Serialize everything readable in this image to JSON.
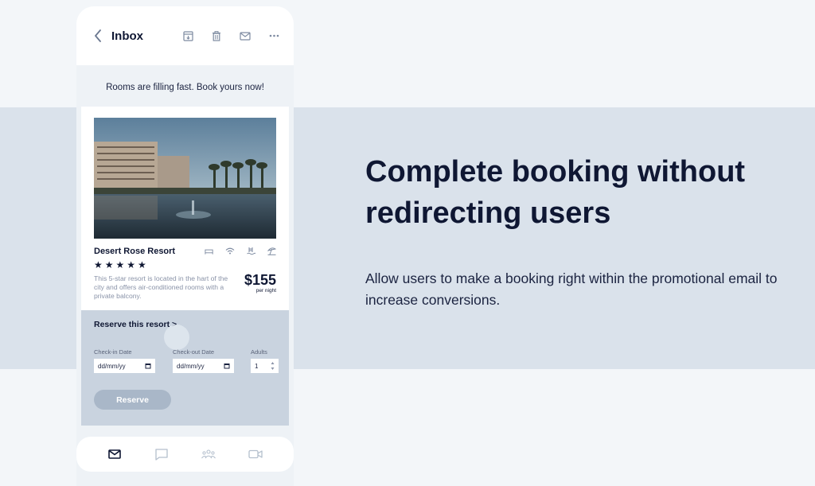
{
  "header": {
    "title": "Inbox",
    "icons": [
      "archive-icon",
      "trash-icon",
      "mail-icon",
      "more-icon"
    ]
  },
  "promo": {
    "text": "Rooms are filling fast. Book yours now!"
  },
  "card": {
    "name": "Desert Rose Resort",
    "stars": "★★★★★",
    "description": "This 5-star resort is located in the hart of the city and offers air-conditioned rooms with a private balcony.",
    "price": "$155",
    "price_unit": "per night",
    "amenities": [
      "bed-icon",
      "wifi-icon",
      "pool-icon",
      "beach-icon"
    ]
  },
  "reserve": {
    "title": "Reserve this resort >",
    "checkin_label": "Check-in Date",
    "checkout_label": "Check-out Date",
    "adults_label": "Adults",
    "checkin_value": "dd/mm/yy",
    "checkout_value": "dd/mm/yy",
    "adults_value": "1",
    "button": "Reserve"
  },
  "tabbar": {
    "items": [
      "mail-icon",
      "chat-icon",
      "people-icon",
      "video-icon"
    ]
  },
  "hero": {
    "headline": "Complete booking without redirecting users",
    "subtext": "Allow users to make a booking right within the promotional email to increase conversions."
  },
  "colors": {
    "accent": "#0f1733",
    "band": "#dae2eb",
    "panel": "#c9d3df",
    "button": "#a9b7c8"
  }
}
